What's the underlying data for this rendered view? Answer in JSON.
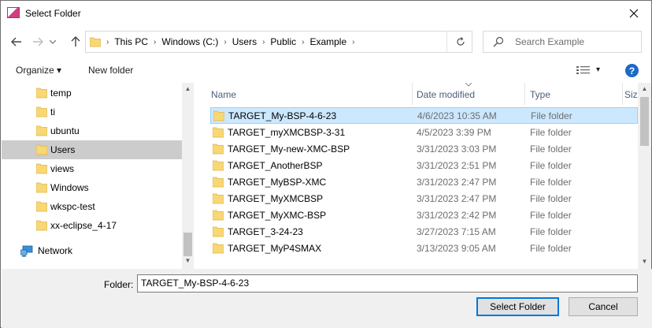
{
  "window": {
    "title": "Select Folder"
  },
  "nav": {
    "back": "←",
    "forward": "→",
    "recent": "⌄",
    "up": "↑",
    "crumbs": [
      "This PC",
      "Windows (C:)",
      "Users",
      "Public",
      "Example"
    ],
    "separator": "›",
    "refresh": "↻",
    "search_placeholder": "Search Example"
  },
  "toolbar": {
    "organize": "Organize ▾",
    "new_folder": "New folder",
    "help": "?",
    "view_arrow": "▾"
  },
  "tree": [
    {
      "label": "temp",
      "selected": false
    },
    {
      "label": "ti",
      "selected": false
    },
    {
      "label": "ubuntu",
      "selected": false
    },
    {
      "label": "Users",
      "selected": true
    },
    {
      "label": "views",
      "selected": false
    },
    {
      "label": "Windows",
      "selected": false
    },
    {
      "label": "wkspc-test",
      "selected": false
    },
    {
      "label": "xx-eclipse_4-17",
      "selected": false
    },
    {
      "label": "Network",
      "selected": false
    }
  ],
  "columns": {
    "name": "Name",
    "date": "Date modified",
    "type": "Type",
    "size": "Size"
  },
  "files": [
    {
      "name": "TARGET_My-BSP-4-6-23",
      "date": "4/6/2023 10:35 AM",
      "type": "File folder",
      "selected": true
    },
    {
      "name": "TARGET_myXMCBSP-3-31",
      "date": "4/5/2023 3:39 PM",
      "type": "File folder"
    },
    {
      "name": "TARGET_My-new-XMC-BSP",
      "date": "3/31/2023 3:03 PM",
      "type": "File folder"
    },
    {
      "name": "TARGET_AnotherBSP",
      "date": "3/31/2023 2:51 PM",
      "type": "File folder"
    },
    {
      "name": "TARGET_MyBSP-XMC",
      "date": "3/31/2023 2:47 PM",
      "type": "File folder"
    },
    {
      "name": "TARGET_MyXMCBSP",
      "date": "3/31/2023 2:47 PM",
      "type": "File folder"
    },
    {
      "name": "TARGET_MyXMC-BSP",
      "date": "3/31/2023 2:42 PM",
      "type": "File folder"
    },
    {
      "name": "TARGET_3-24-23",
      "date": "3/27/2023 7:15 AM",
      "type": "File folder"
    },
    {
      "name": "TARGET_MyP4SMAX",
      "date": "3/13/2023 9:05 AM",
      "type": "File folder"
    }
  ],
  "bottom": {
    "folder_label": "Folder:",
    "folder_value": "TARGET_My-BSP-4-6-23",
    "select_button": "Select Folder",
    "cancel_button": "Cancel"
  },
  "colors": {
    "accent": "#0078d7",
    "folder": "#f8d775",
    "selection": "#cce8ff"
  }
}
